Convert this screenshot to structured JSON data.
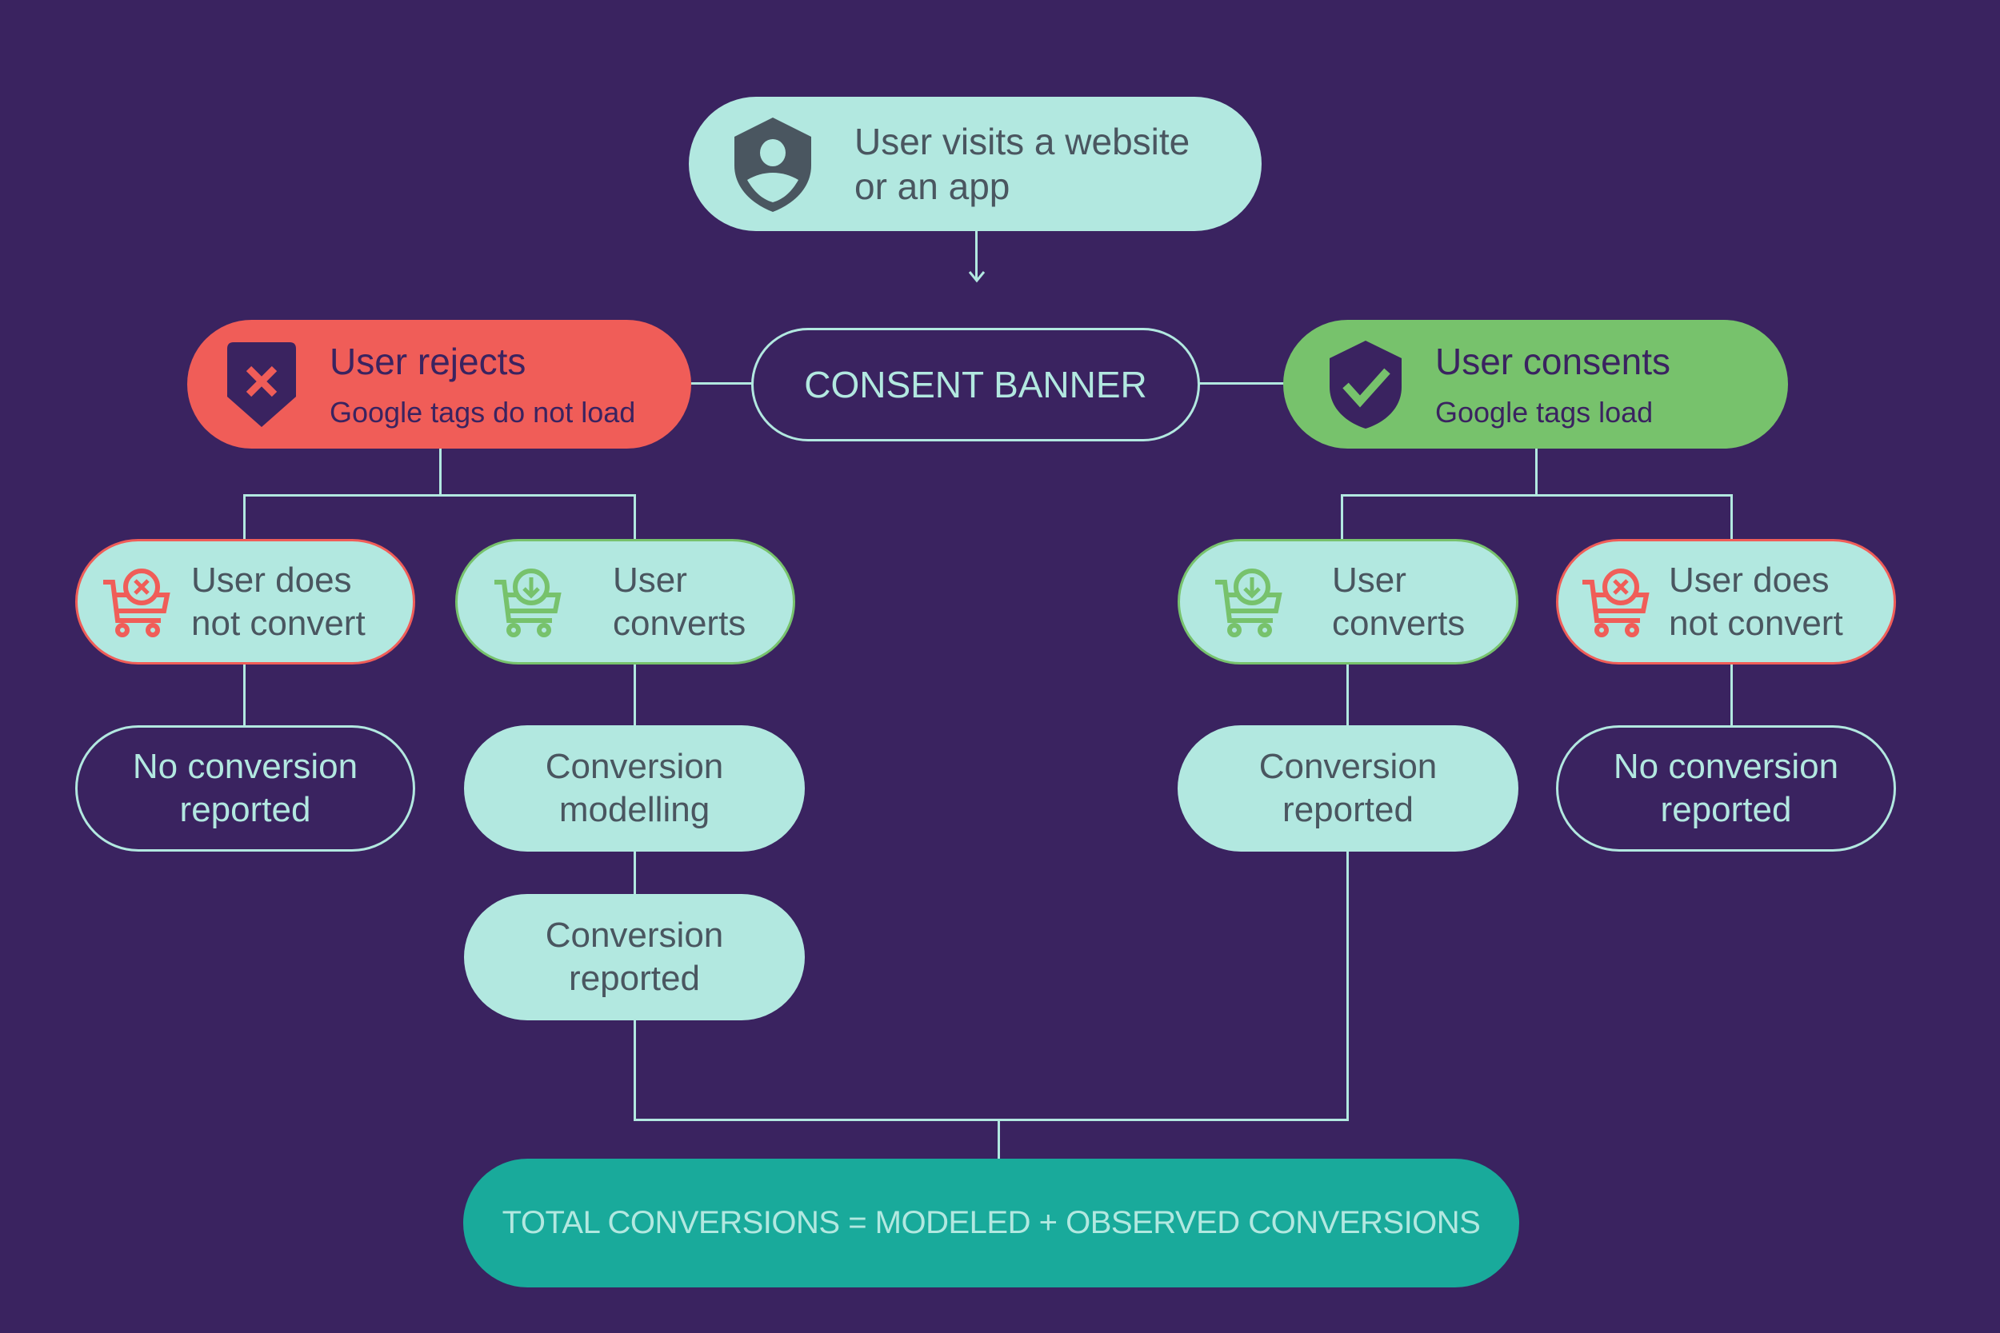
{
  "colors": {
    "background": "#3a2360",
    "mint": "#b2e8e0",
    "text_dark": "#4a5660",
    "reject_red": "#f05d58",
    "consent_green": "#77c26c",
    "total_teal": "#19aa9b"
  },
  "start": {
    "icon": "user-shield-icon",
    "label": "User visits a website\nor an app"
  },
  "banner": {
    "label": "CONSENT BANNER"
  },
  "reject": {
    "icon": "shield-x-icon",
    "title": "User rejects",
    "subtitle": "Google tags do not load",
    "branches": {
      "no_convert": {
        "icon": "cart-x-icon",
        "label": "User does\nnot convert",
        "result": "No conversion\nreported"
      },
      "convert": {
        "icon": "cart-download-icon",
        "label": "User\nconverts",
        "step": "Conversion\nmodelling",
        "result": "Conversion\nreported"
      }
    }
  },
  "consent": {
    "icon": "shield-check-icon",
    "title": "User consents",
    "subtitle": "Google tags load",
    "branches": {
      "convert": {
        "icon": "cart-download-icon",
        "label": "User\nconverts",
        "result": "Conversion\nreported"
      },
      "no_convert": {
        "icon": "cart-x-icon",
        "label": "User does\nnot convert",
        "result": "No conversion\nreported"
      }
    }
  },
  "total": {
    "label": "TOTAL CONVERSIONS = MODELED + OBSERVED CONVERSIONS"
  }
}
